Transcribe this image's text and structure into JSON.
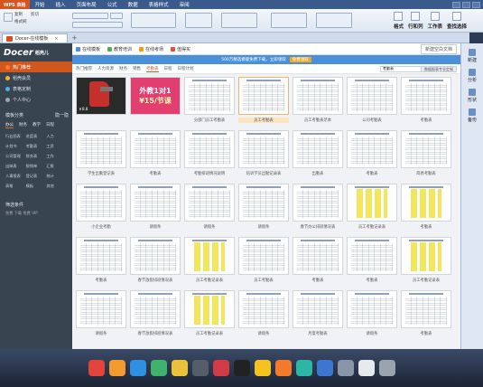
{
  "menubar": {
    "app_button": "WPS 表格",
    "items": [
      "开始",
      "插入",
      "页面布局",
      "公式",
      "数据",
      "表格样式",
      "审阅"
    ]
  },
  "ribbon": {
    "clipboard": [
      "复制",
      "格式刷",
      "剪切"
    ],
    "right_groups": [
      "格式",
      "行和列",
      "工作表",
      "查找选择"
    ]
  },
  "tabs": [
    {
      "label": "Docer-在线模板"
    }
  ],
  "sidebar": {
    "brand": "Docer",
    "brand_sub": "稻壳儿",
    "items": [
      {
        "label": "热门推荐",
        "color": "#ff7a2e",
        "active": true
      },
      {
        "label": "稻壳会员",
        "color": "#f3b23a",
        "active": false
      },
      {
        "label": "表格定制",
        "color": "#4bb3e8",
        "active": false
      },
      {
        "label": "个人中心",
        "color": "#9aa6b3",
        "active": false
      }
    ],
    "section_title": "模板分类",
    "section_action": "隐一隐",
    "section_tabs": [
      "办公",
      "财务",
      "教学",
      "日程"
    ],
    "categories": [
      "行业图表",
      "进度表",
      "人力",
      "计划书",
      "考勤表",
      "工资",
      "公司管理",
      "财务表",
      "工作",
      "出纳表",
      "报销单",
      "汇报",
      "人事报表",
      "登记表",
      "统计",
      "表格",
      "模板",
      "其他"
    ],
    "filter_title": "筛选条件",
    "filter_sub": [
      "免费",
      "下载",
      "免费",
      "VIP"
    ]
  },
  "toolbar2": {
    "items": [
      {
        "label": "在线模板",
        "color": "#4a90d9"
      },
      {
        "label": "教育培训",
        "color": "#4caf50"
      },
      {
        "label": "在线考场",
        "color": "#f39c12"
      },
      {
        "label": "值得买",
        "color": "#e74c3c"
      }
    ],
    "right_button": "新建空白文档"
  },
  "banner": {
    "text": "500万精选模版免费下载，立即领取",
    "button": "免费领取"
  },
  "filterbar": {
    "items": [
      "热门推荐",
      "人力资源",
      "财务",
      "销售",
      "考勤表",
      "日程",
      "日程计划"
    ],
    "active": 4,
    "search_placeholder": "搜索你想要的模板",
    "search_value": "考勤表",
    "search_button": "数据报表专业定制"
  },
  "templates": [
    {
      "label": "",
      "kind": "promo1",
      "price": "￥8.8"
    },
    {
      "label": "",
      "kind": "promo2",
      "line1": "外教1对1",
      "line2": "¥15/节课"
    },
    {
      "label": "分部门员工考勤表",
      "kind": "lines"
    },
    {
      "label": "员工考勤表",
      "kind": "lines",
      "selected": true
    },
    {
      "label": "员工考勤表范本",
      "kind": "lines"
    },
    {
      "label": "公司考勤表",
      "kind": "lines"
    },
    {
      "label": "考勤表",
      "kind": "lines"
    },
    {
      "label": "学生出勤登记表",
      "kind": "lines"
    },
    {
      "label": "考勤表",
      "kind": "lines"
    },
    {
      "label": "考勤排班情况说明",
      "kind": "lines"
    },
    {
      "label": "培训学员出勤记录表",
      "kind": "lines"
    },
    {
      "label": "出勤表",
      "kind": "lines"
    },
    {
      "label": "考勤表",
      "kind": "lines"
    },
    {
      "label": "简易考勤表",
      "kind": "lines"
    },
    {
      "label": "小企业考勤",
      "kind": "lines"
    },
    {
      "label": "请假条",
      "kind": "lines"
    },
    {
      "label": "请假条",
      "kind": "lines"
    },
    {
      "label": "请假条",
      "kind": "lines"
    },
    {
      "label": "春节办公排班情况表",
      "kind": "lines"
    },
    {
      "label": "员工考勤记录表",
      "kind": "yellow"
    },
    {
      "label": "考勤表",
      "kind": "yellow"
    },
    {
      "label": "考勤表",
      "kind": "lines"
    },
    {
      "label": "春节放假排班情况表",
      "kind": "lines"
    },
    {
      "label": "员工考勤记录表",
      "kind": "yellow"
    },
    {
      "label": "员工考勤表",
      "kind": "lines"
    },
    {
      "label": "考勤表",
      "kind": "lines"
    },
    {
      "label": "考勤表",
      "kind": "lines"
    },
    {
      "label": "员工考勤记录表",
      "kind": "yellow"
    },
    {
      "label": "请假条",
      "kind": "lines"
    },
    {
      "label": "春节放假排班情况表",
      "kind": "lines"
    },
    {
      "label": "员工考勤记录表",
      "kind": "yellow"
    },
    {
      "label": "请假条",
      "kind": "lines"
    },
    {
      "label": "月度考勤表",
      "kind": "lines"
    },
    {
      "label": "请假条",
      "kind": "lines"
    },
    {
      "label": "考勤表",
      "kind": "lines"
    }
  ],
  "rightpanel": [
    {
      "label": "新建"
    },
    {
      "label": "分析"
    },
    {
      "label": "形状"
    },
    {
      "label": "备份"
    }
  ],
  "dock": {
    "apps": [
      {
        "name": "app-red",
        "color": "#e2433b"
      },
      {
        "name": "app-orange",
        "color": "#f29a2e"
      },
      {
        "name": "app-blue",
        "color": "#2f8fe0"
      },
      {
        "name": "app-green",
        "color": "#3fb36b"
      },
      {
        "name": "app-chrome",
        "color": "#e8c33a"
      },
      {
        "name": "app-dark",
        "color": "#555d6b"
      },
      {
        "name": "app-red2",
        "color": "#d23a45"
      },
      {
        "name": "app-black",
        "color": "#222222"
      },
      {
        "name": "app-yellow",
        "color": "#f5c21f"
      },
      {
        "name": "app-orange2",
        "color": "#f27a2a"
      },
      {
        "name": "app-teal",
        "color": "#2db5a8"
      },
      {
        "name": "app-blue2",
        "color": "#3d76d0"
      },
      {
        "name": "app-gray",
        "color": "#8896a8"
      },
      {
        "name": "app-white",
        "color": "#e6e9ee"
      },
      {
        "name": "app-trash",
        "color": "#9aa3ae"
      }
    ]
  }
}
